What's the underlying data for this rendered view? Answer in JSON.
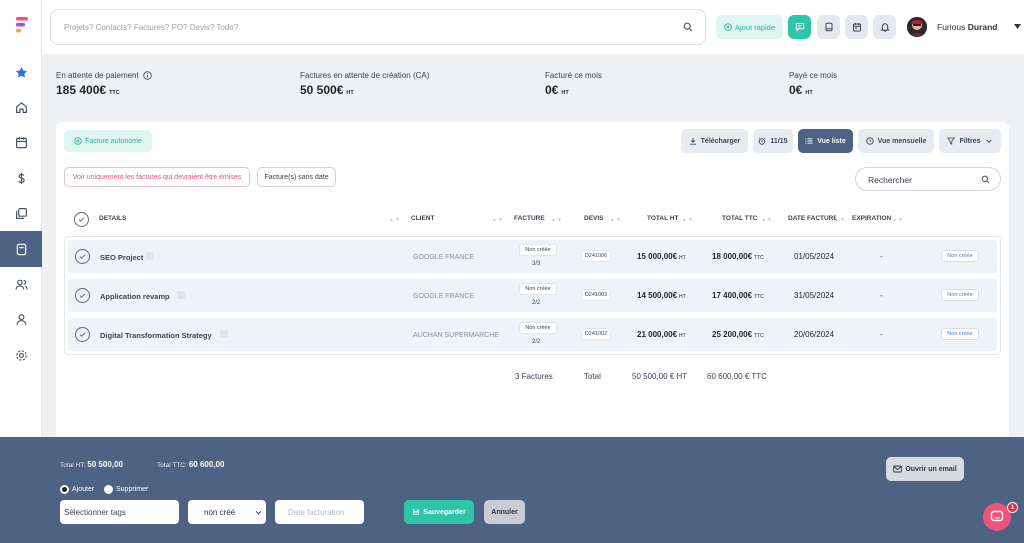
{
  "search": {
    "placeholder": "Projets? Contacts? Factures? PO? Devis? Todo?"
  },
  "header": {
    "quick_add_label": "Ajout rapide",
    "user_first": "Furious",
    "user_last": "Durand"
  },
  "stats": [
    {
      "label": "En attente de paiement",
      "value": "185 400€",
      "suffix": "TTC"
    },
    {
      "label": "Factures en attente de création (CA)",
      "value": "50 500€",
      "suffix": "HT"
    },
    {
      "label": "Facturé ce mois",
      "value": "0€",
      "suffix": "HT"
    },
    {
      "label": "Payé ce mois",
      "value": "0€",
      "suffix": "HT"
    }
  ],
  "toolbar": {
    "autonome_label": "Facture autonome",
    "download_label": "Télécharger",
    "counter_label": "11/15",
    "list_view_label": "Vue liste",
    "month_view_label": "Vue mensuelle",
    "filters_label": "Filtres",
    "only_emitted_label": "Voir uniquement les factures qui devraient être émises",
    "undated_label": "Facture(s) sans date",
    "search_placeholder": "Rechercher"
  },
  "table": {
    "headers": {
      "details": "DETAILS",
      "client": "CLIENT",
      "facture": "FACTURE",
      "devis": "DEVIS",
      "total_ht": "TOTAL HT",
      "total_ttc": "TOTAL TTC",
      "date": "DATE FACTURE",
      "expiration": "EXPIRATION"
    },
    "rows": [
      {
        "name": "SEO Project",
        "client": "GOOGLE FRANCE",
        "facture_status": "Non créée",
        "facture_count": "3/3",
        "devis": "D241006",
        "total_ht": "15 000,00€",
        "ht_unit": "HT",
        "total_ttc": "18 000,00€",
        "ttc_unit": "TTC",
        "date": "01/05/2024",
        "expiration": "-",
        "status": "Non créée"
      },
      {
        "name": "Application revamp",
        "client": "GOOGLE FRANCE",
        "facture_status": "Non créée",
        "facture_count": "2/2",
        "devis": "D241003",
        "total_ht": "14 500,00€",
        "ht_unit": "HT",
        "total_ttc": "17 400,00€",
        "ttc_unit": "TTC",
        "date": "31/05/2024",
        "expiration": "-",
        "status": "Non créée"
      },
      {
        "name": "Digital Transformation Strategy",
        "client": "AUCHAN SUPERMARCHE",
        "facture_status": "Non créée",
        "facture_count": "2/2",
        "devis": "D241002",
        "total_ht": "21 000,00€",
        "ht_unit": "HT",
        "total_ttc": "25 200,00€",
        "ttc_unit": "TTC",
        "date": "20/06/2024",
        "expiration": "-",
        "status": "Non créée"
      }
    ],
    "footer": {
      "count": "3 Factures",
      "label": "Total",
      "total_ht": "50 500,00 € HT",
      "total_ttc": "60 600,00 € TTC"
    }
  },
  "bottom": {
    "total_ht_label": "Total HT:",
    "total_ht_value": "50 500,00",
    "total_ttc_label": "Total TTC:",
    "total_ttc_value": "60 600,00",
    "radio_add": "Ajouter",
    "radio_remove": "Supprimer",
    "tags_placeholder": "Sélectionner tags",
    "status_select": "non créé",
    "date_placeholder": "Date facturation",
    "save_label": "Sauvegarder",
    "cancel_label": "Annuler",
    "email_label": "Ouvrir un email"
  },
  "chat": {
    "badge": "1"
  },
  "colors": {
    "accent": "#2ec4a6",
    "navy": "#4e6283",
    "pink": "#e0577d"
  }
}
